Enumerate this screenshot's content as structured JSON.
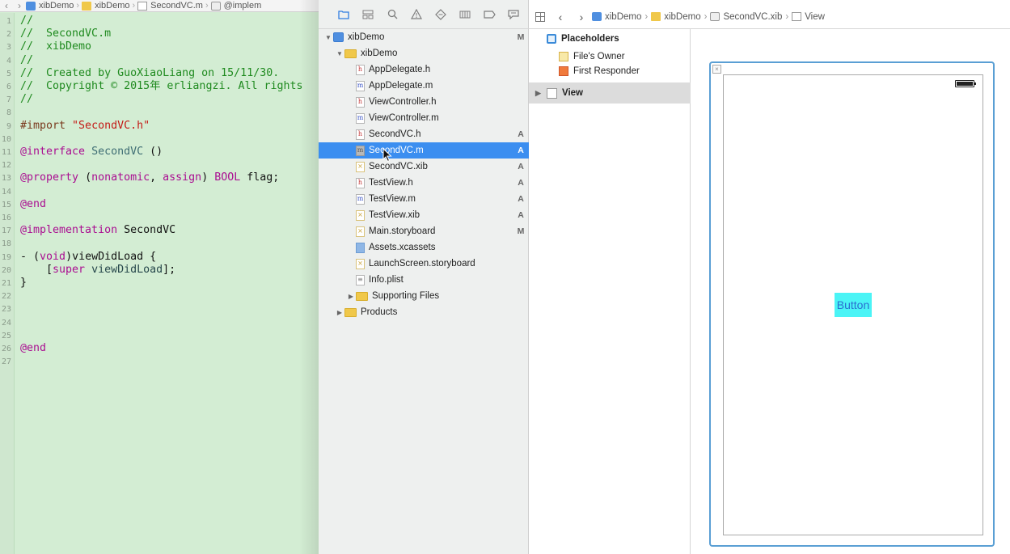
{
  "editor": {
    "jumpbar": [
      "xibDemo",
      "xibDemo",
      "SecondVC.m",
      "@implem"
    ],
    "lines": [
      {
        "n": "1",
        "tokens": [
          {
            "t": "//",
            "c": "comment"
          }
        ]
      },
      {
        "n": "2",
        "tokens": [
          {
            "t": "//  SecondVC.m",
            "c": "comment"
          }
        ]
      },
      {
        "n": "3",
        "tokens": [
          {
            "t": "//  xibDemo",
            "c": "comment"
          }
        ]
      },
      {
        "n": "4",
        "tokens": [
          {
            "t": "//",
            "c": "comment"
          }
        ]
      },
      {
        "n": "5",
        "tokens": [
          {
            "t": "//  Created by GuoXiaoLiang on 15/11/30.",
            "c": "comment"
          }
        ]
      },
      {
        "n": "6",
        "tokens": [
          {
            "t": "//  Copyright © 2015年 erliangzi. All rights",
            "c": "comment"
          }
        ]
      },
      {
        "n": "7",
        "tokens": [
          {
            "t": "//",
            "c": "comment"
          }
        ]
      },
      {
        "n": "8",
        "tokens": []
      },
      {
        "n": "9",
        "tokens": [
          {
            "t": "#import ",
            "c": "pre"
          },
          {
            "t": "\"SecondVC.h\"",
            "c": "str"
          }
        ]
      },
      {
        "n": "10",
        "tokens": []
      },
      {
        "n": "11",
        "tokens": [
          {
            "t": "@interface ",
            "c": "kw"
          },
          {
            "t": "SecondVC",
            "c": "cls"
          },
          {
            "t": " ()",
            "c": "plain"
          }
        ]
      },
      {
        "n": "12",
        "tokens": []
      },
      {
        "n": "13",
        "tokens": [
          {
            "t": "@property ",
            "c": "kw"
          },
          {
            "t": "(",
            "c": "plain"
          },
          {
            "t": "nonatomic",
            "c": "kw"
          },
          {
            "t": ", ",
            "c": "plain"
          },
          {
            "t": "assign",
            "c": "kw"
          },
          {
            "t": ") ",
            "c": "plain"
          },
          {
            "t": "BOOL",
            "c": "kw"
          },
          {
            "t": " flag;",
            "c": "plain"
          }
        ]
      },
      {
        "n": "14",
        "tokens": []
      },
      {
        "n": "15",
        "tokens": [
          {
            "t": "@end",
            "c": "kw"
          }
        ]
      },
      {
        "n": "16",
        "tokens": []
      },
      {
        "n": "17",
        "tokens": [
          {
            "t": "@implementation ",
            "c": "kw"
          },
          {
            "t": "SecondVC",
            "c": "plain"
          }
        ]
      },
      {
        "n": "18",
        "tokens": []
      },
      {
        "n": "19",
        "tokens": [
          {
            "t": "- (",
            "c": "plain"
          },
          {
            "t": "void",
            "c": "kw"
          },
          {
            "t": ")viewDidLoad {",
            "c": "plain"
          }
        ]
      },
      {
        "n": "20",
        "tokens": [
          {
            "t": "    [",
            "c": "plain"
          },
          {
            "t": "super",
            "c": "kw"
          },
          {
            "t": " ",
            "c": "plain"
          },
          {
            "t": "viewDidLoad",
            "c": "id"
          },
          {
            "t": "];",
            "c": "plain"
          }
        ]
      },
      {
        "n": "21",
        "tokens": [
          {
            "t": "}",
            "c": "plain"
          }
        ]
      },
      {
        "n": "22",
        "tokens": []
      },
      {
        "n": "23",
        "tokens": []
      },
      {
        "n": "24",
        "tokens": []
      },
      {
        "n": "25",
        "tokens": []
      },
      {
        "n": "26",
        "tokens": [
          {
            "t": "@end",
            "c": "kw"
          }
        ]
      },
      {
        "n": "27",
        "tokens": []
      }
    ]
  },
  "navigator": {
    "tools": [
      "folder-icon",
      "hierarchy-icon",
      "search-icon",
      "warning-icon",
      "test-icon",
      "debug-icon",
      "breakpoint-icon",
      "report-icon"
    ],
    "items": [
      {
        "label": "xibDemo",
        "icon": "proj",
        "depth": 0,
        "disclosure": "open",
        "badge": "M"
      },
      {
        "label": "xibDemo",
        "icon": "folder",
        "depth": 1,
        "disclosure": "open",
        "badge": ""
      },
      {
        "label": "AppDelegate.h",
        "icon": "h",
        "depth": 2,
        "disclosure": "",
        "badge": ""
      },
      {
        "label": "AppDelegate.m",
        "icon": "m",
        "depth": 2,
        "disclosure": "",
        "badge": ""
      },
      {
        "label": "ViewController.h",
        "icon": "h",
        "depth": 2,
        "disclosure": "",
        "badge": ""
      },
      {
        "label": "ViewController.m",
        "icon": "m",
        "depth": 2,
        "disclosure": "",
        "badge": ""
      },
      {
        "label": "SecondVC.h",
        "icon": "h",
        "depth": 2,
        "disclosure": "",
        "badge": "A"
      },
      {
        "label": "SecondVC.m",
        "icon": "selm",
        "depth": 2,
        "disclosure": "",
        "badge": "A",
        "selected": true
      },
      {
        "label": "SecondVC.xib",
        "icon": "xib",
        "depth": 2,
        "disclosure": "",
        "badge": "A"
      },
      {
        "label": "TestView.h",
        "icon": "h",
        "depth": 2,
        "disclosure": "",
        "badge": "A"
      },
      {
        "label": "TestView.m",
        "icon": "m",
        "depth": 2,
        "disclosure": "",
        "badge": "A"
      },
      {
        "label": "TestView.xib",
        "icon": "xib",
        "depth": 2,
        "disclosure": "",
        "badge": "A"
      },
      {
        "label": "Main.storyboard",
        "icon": "sb",
        "depth": 2,
        "disclosure": "",
        "badge": "M"
      },
      {
        "label": "Assets.xcassets",
        "icon": "assets",
        "depth": 2,
        "disclosure": "",
        "badge": ""
      },
      {
        "label": "LaunchScreen.storyboard",
        "icon": "sb",
        "depth": 2,
        "disclosure": "",
        "badge": ""
      },
      {
        "label": "Info.plist",
        "icon": "plist",
        "depth": 2,
        "disclosure": "",
        "badge": ""
      },
      {
        "label": "Supporting Files",
        "icon": "folder",
        "depth": 2,
        "disclosure": "closed",
        "badge": ""
      },
      {
        "label": "Products",
        "icon": "folder",
        "depth": 1,
        "disclosure": "closed",
        "badge": ""
      }
    ]
  },
  "ib_jumpbar": [
    "xibDemo",
    "xibDemo",
    "SecondVC.xib",
    "View"
  ],
  "outline": {
    "placeholders": "Placeholders",
    "files_owner": "File's Owner",
    "first_responder": "First Responder",
    "view": "View"
  },
  "canvas": {
    "button_label": "Button",
    "button_bg": "#4bf4f6",
    "button_text_color": "#2a6fd1",
    "battery_level": 1.0
  },
  "colors": {
    "editor_bg": "#d3edd3",
    "selection": "#3b8ef0",
    "scene_border": "#5a9fd4"
  }
}
